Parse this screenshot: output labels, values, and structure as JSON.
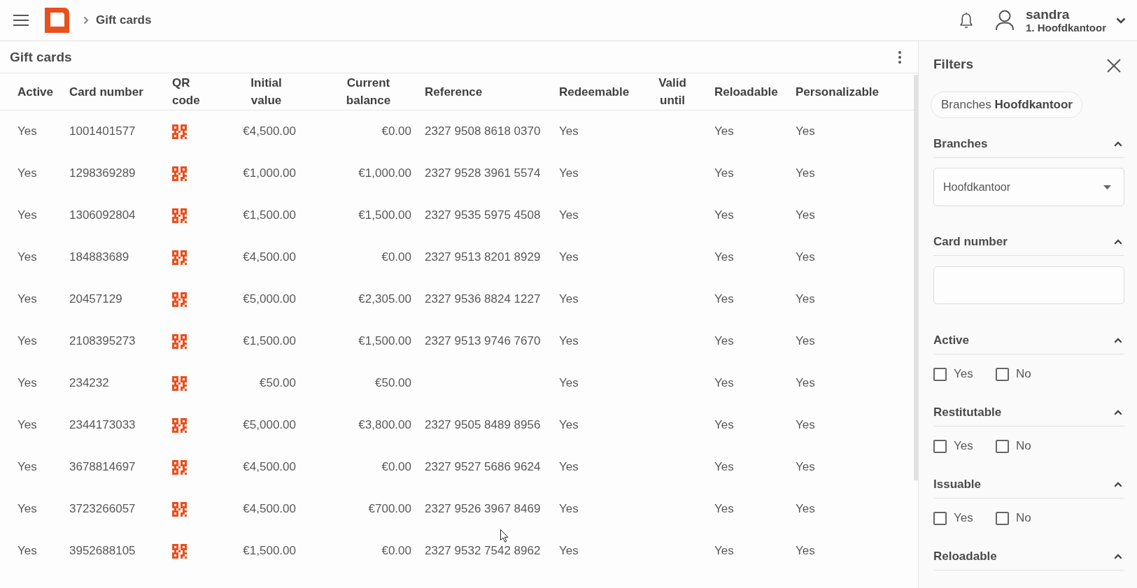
{
  "top_bar": {
    "breadcrumb": "Gift cards",
    "user": {
      "name": "sandra",
      "branch": "1. Hoofdkantoor"
    }
  },
  "panel": {
    "title": "Gift cards"
  },
  "table": {
    "columns": [
      "Active",
      "Card number",
      "QR code",
      "Initial value",
      "Current balance",
      "Reference",
      "Redeemable",
      "Valid until",
      "Reloadable",
      "Personalizable"
    ],
    "rows": [
      {
        "active": "Yes",
        "card_number": "1001401577",
        "initial_value": "€4,500.00",
        "current_balance": "€0.00",
        "reference": "2327 9508 8618 0370",
        "redeemable": "Yes",
        "reloadable": "Yes",
        "personalizable": "Yes"
      },
      {
        "active": "Yes",
        "card_number": "1298369289",
        "initial_value": "€1,000.00",
        "current_balance": "€1,000.00",
        "reference": "2327 9528 3961 5574",
        "redeemable": "Yes",
        "reloadable": "Yes",
        "personalizable": "Yes"
      },
      {
        "active": "Yes",
        "card_number": "1306092804",
        "initial_value": "€1,500.00",
        "current_balance": "€1,500.00",
        "reference": "2327 9535 5975 4508",
        "redeemable": "Yes",
        "reloadable": "Yes",
        "personalizable": "Yes"
      },
      {
        "active": "Yes",
        "card_number": "184883689",
        "initial_value": "€4,500.00",
        "current_balance": "€0.00",
        "reference": "2327 9513 8201 8929",
        "redeemable": "Yes",
        "reloadable": "Yes",
        "personalizable": "Yes"
      },
      {
        "active": "Yes",
        "card_number": "20457129",
        "initial_value": "€5,000.00",
        "current_balance": "€2,305.00",
        "reference": "2327 9536 8824 1227",
        "redeemable": "Yes",
        "reloadable": "Yes",
        "personalizable": "Yes"
      },
      {
        "active": "Yes",
        "card_number": "2108395273",
        "initial_value": "€1,500.00",
        "current_balance": "€1,500.00",
        "reference": "2327 9513 9746 7670",
        "redeemable": "Yes",
        "reloadable": "Yes",
        "personalizable": "Yes"
      },
      {
        "active": "Yes",
        "card_number": "234232",
        "initial_value": "€50.00",
        "current_balance": "€50.00",
        "redeemable": "Yes",
        "reloadable": "Yes",
        "personalizable": "Yes"
      },
      {
        "active": "Yes",
        "card_number": "2344173033",
        "initial_value": "€5,000.00",
        "current_balance": "€3,800.00",
        "reference": "2327 9505 8489 8956",
        "redeemable": "Yes",
        "reloadable": "Yes",
        "personalizable": "Yes"
      },
      {
        "active": "Yes",
        "card_number": "3678814697",
        "initial_value": "€4,500.00",
        "current_balance": "€0.00",
        "reference": "2327 9527 5686 9624",
        "redeemable": "Yes",
        "reloadable": "Yes",
        "personalizable": "Yes"
      },
      {
        "active": "Yes",
        "card_number": "3723266057",
        "initial_value": "€4,500.00",
        "current_balance": "€700.00",
        "reference": "2327 9526 3967 8469",
        "redeemable": "Yes",
        "reloadable": "Yes",
        "personalizable": "Yes"
      },
      {
        "active": "Yes",
        "card_number": "3952688105",
        "initial_value": "€1,500.00",
        "current_balance": "€0.00",
        "reference": "2327 9532 7542 8962",
        "redeemable": "Yes",
        "reloadable": "Yes",
        "personalizable": "Yes"
      }
    ]
  },
  "filters": {
    "title": "Filters",
    "chips": [
      "Branches **Hoofdkantoor**"
    ],
    "sections": [
      {
        "kind": "dropdown",
        "title": "Branches",
        "expanded": true,
        "value": "Hoofdkantoor"
      },
      {
        "kind": "text",
        "title": "Card number",
        "expanded": true
      },
      {
        "kind": "checkboxes",
        "title": "Active",
        "expanded": true,
        "options": [
          {
            "label": "Yes",
            "checked": false
          },
          {
            "label": "No",
            "checked": false
          }
        ]
      },
      {
        "kind": "checkboxes",
        "title": "Restitutable",
        "expanded": true,
        "options": [
          {
            "label": "Yes",
            "checked": false
          },
          {
            "label": "No",
            "checked": false
          }
        ]
      },
      {
        "kind": "checkboxes",
        "title": "Issuable",
        "expanded": true,
        "options": [
          {
            "label": "Yes",
            "checked": false
          },
          {
            "label": "No",
            "checked": false
          }
        ]
      },
      {
        "kind": "checkboxes",
        "title": "Reloadable",
        "expanded": true
      }
    ]
  }
}
